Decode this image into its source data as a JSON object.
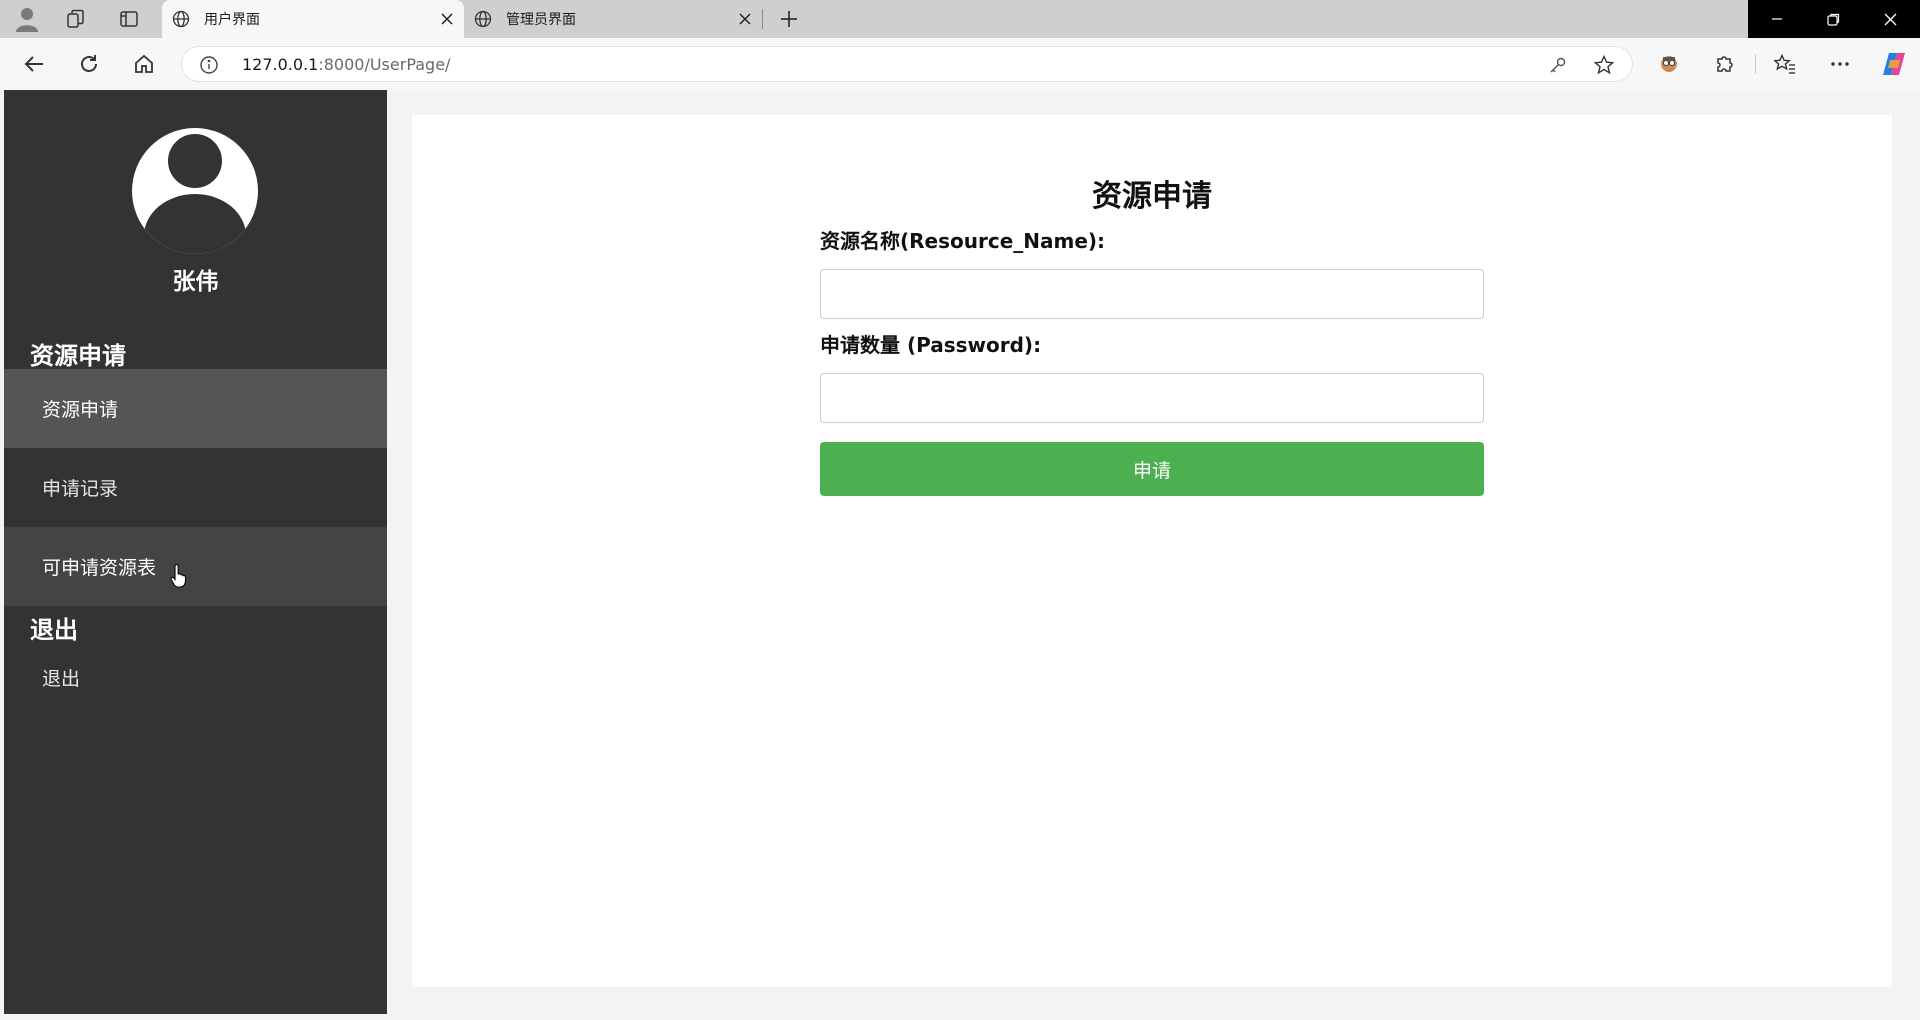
{
  "browser": {
    "tabs": [
      {
        "title": "用户界面",
        "active": true
      },
      {
        "title": "管理员界面",
        "active": false
      }
    ],
    "url": {
      "host": "127.0.0.1",
      "rest": ":8000/UserPage/"
    }
  },
  "sidebar": {
    "username": "张伟",
    "sections": [
      {
        "title": "资源申请",
        "items": [
          {
            "label": "资源申请"
          },
          {
            "label": "申请记录"
          },
          {
            "label": "可申请资源表"
          }
        ]
      },
      {
        "title": "退出",
        "items": [
          {
            "label": "退出"
          }
        ]
      }
    ]
  },
  "form": {
    "title": "资源申请",
    "resource_name_label": "资源名称(Resource_Name):",
    "resource_name_value": "",
    "quantity_label": "申请数量 (Password):",
    "quantity_value": "",
    "submit_label": "申请"
  },
  "colors": {
    "sidebar_bg": "#333333",
    "sidebar_active": "#555555",
    "submit_button": "#4caf50"
  }
}
